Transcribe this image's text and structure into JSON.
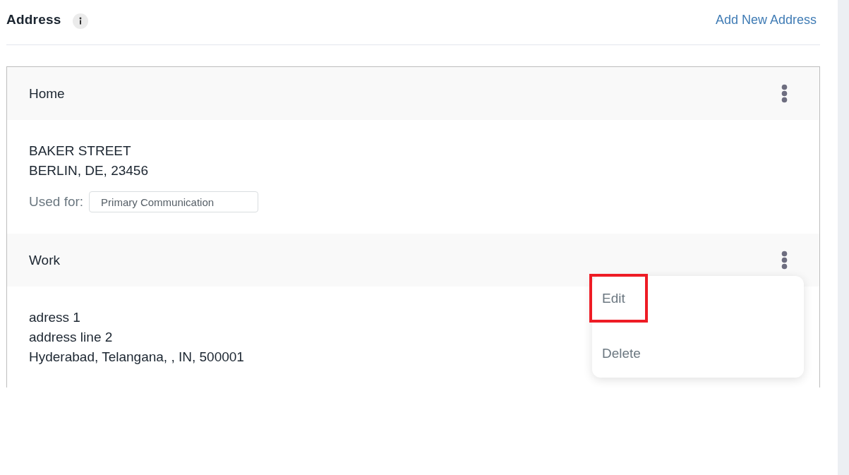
{
  "header": {
    "title": "Address",
    "add_link": "Add New Address"
  },
  "addresses": [
    {
      "label": "Home",
      "lines": [
        "BAKER STREET",
        "BERLIN, DE, 23456"
      ],
      "used_for": {
        "label": "Used for:",
        "tags": [
          "Primary Communication"
        ]
      }
    },
    {
      "label": "Work",
      "lines": [
        "adress 1",
        "address line 2",
        "Hyderabad, Telangana, , IN, 500001"
      ],
      "menu": {
        "open": true,
        "items": [
          {
            "label": "Edit",
            "highlighted": true
          },
          {
            "label": "Delete",
            "highlighted": false
          }
        ]
      }
    }
  ]
}
